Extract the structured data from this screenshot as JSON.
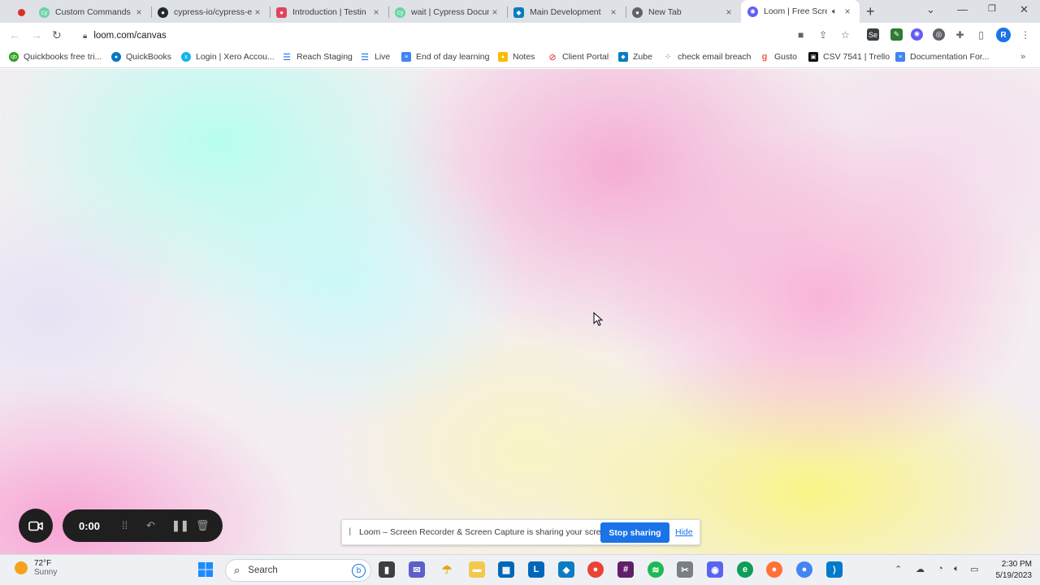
{
  "browser": {
    "tabs": [
      {
        "title": "Custom Commands",
        "close": "×"
      },
      {
        "title": "cypress-io/cypress-e",
        "close": "×"
      },
      {
        "title": "Introduction | Testin",
        "close": "×"
      },
      {
        "title": "wait | Cypress Docum",
        "close": "×"
      },
      {
        "title": "Main Development",
        "close": "×"
      },
      {
        "title": "New Tab",
        "close": "×"
      },
      {
        "title": "Loom | Free Scre",
        "close": "×"
      }
    ],
    "new_tab_glyph": "+",
    "url": "loom.com/canvas",
    "profile_initial": "R",
    "bookmarks": [
      {
        "label": "Quickbooks free tri..."
      },
      {
        "label": "QuickBooks"
      },
      {
        "label": "Login | Xero Accou..."
      },
      {
        "label": "Reach Staging"
      },
      {
        "label": "Live"
      },
      {
        "label": "End of day learning"
      },
      {
        "label": "Notes"
      },
      {
        "label": "Client Portal"
      },
      {
        "label": "Zube"
      },
      {
        "label": "check email breach"
      },
      {
        "label": "Gusto"
      },
      {
        "label": "CSV 7541 | Trello"
      },
      {
        "label": "Documentation For..."
      }
    ]
  },
  "loom": {
    "timer": "0:00",
    "share_message": "Loom – Screen Recorder & Screen Capture is sharing your screen.",
    "stop_sharing_label": "Stop sharing",
    "hide_label": "Hide"
  },
  "taskbar": {
    "weather_temp": "72°F",
    "weather_desc": "Sunny",
    "search_label": "Search",
    "time": "2:30 PM",
    "date": "5/19/2023"
  },
  "colors": {
    "accent": "#1a73e8",
    "recorder_bg": "#1f1f1f"
  }
}
